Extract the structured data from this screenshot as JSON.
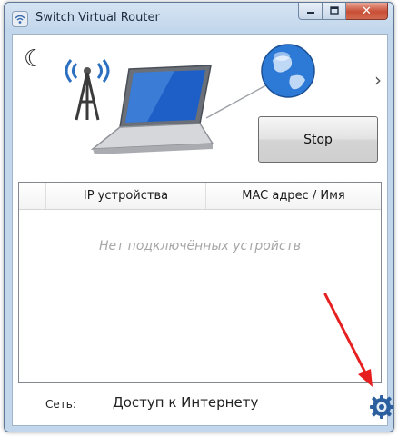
{
  "window": {
    "title": "Switch Virtual Router"
  },
  "titlebar": {
    "minimize_glyph": "—",
    "maximize_glyph": "□",
    "close_glyph": "✕"
  },
  "header": {
    "moon_icon_glyph": "☾",
    "next_glyph": "›"
  },
  "controls": {
    "stop_label": "Stop"
  },
  "device_table": {
    "columns": [
      "",
      "IP устройства",
      "MAC адрес / Имя"
    ],
    "empty_message": "Нет подключённых устройств"
  },
  "status": {
    "label": "Сеть:",
    "value": "Доступ к Интернету"
  },
  "colors": {
    "accent_blue": "#2a6fc0",
    "annotation_red": "#e62020"
  },
  "icons": {
    "app": "wifi-icon",
    "hero": "router-laptop-globe",
    "settings": "gear-icon"
  }
}
